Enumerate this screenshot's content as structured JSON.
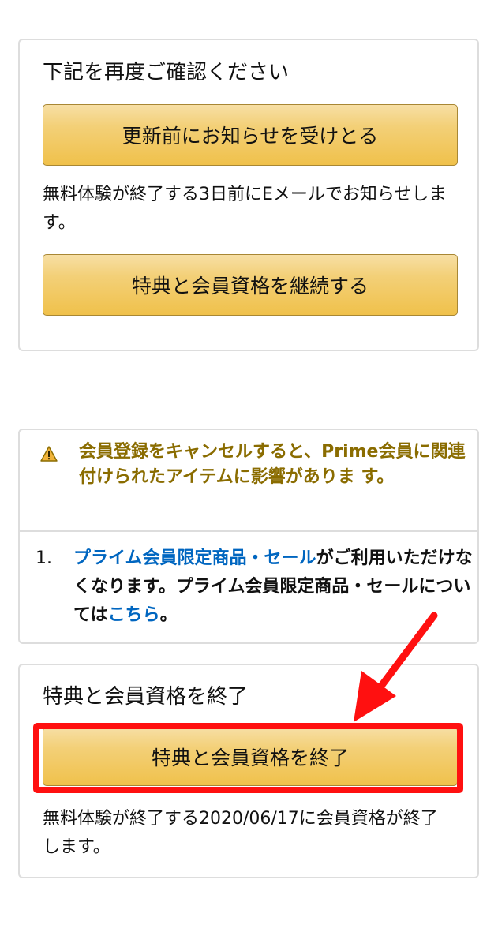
{
  "confirm_section": {
    "heading": "下記を再度ご確認ください",
    "notify_button": "更新前にお知らせを受けとる",
    "notify_description": "無料体験が終了する3日前にEメールでお知らせします。",
    "continue_button": "特典と会員資格を継続する"
  },
  "warning_section": {
    "icon": "warning-triangle-icon",
    "message": "会員登録をキャンセルすると、Prime会員に関連付けられたアイテムに影響がありま す。",
    "items": [
      {
        "number": "1.",
        "link_text": "プライム会員限定商品・セール",
        "text_middle": "がご利用いただけなくなります。プライム会員限定商品・セールについては",
        "link_here": "こちら",
        "text_end": "。"
      }
    ]
  },
  "end_section": {
    "heading": "特典と会員資格を終了",
    "end_button": "特典と会員資格を終了",
    "end_description": "無料体験が終了する2020/06/17に会員資格が終了します。"
  },
  "annotation": {
    "highlight_color": "#ff1010",
    "arrow_color": "#ff1010"
  },
  "colors": {
    "button_gradient_top": "#f7dfa5",
    "button_gradient_bottom": "#f0c14b",
    "button_border": "#a88734",
    "warning_text": "#8a6c00",
    "link": "#0066c0"
  }
}
